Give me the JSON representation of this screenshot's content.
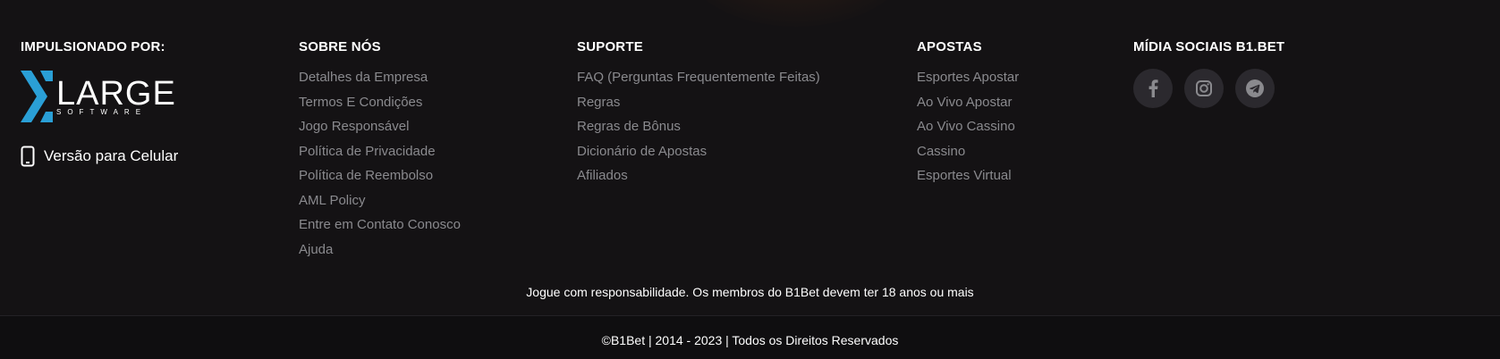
{
  "powered": {
    "heading": "IMPULSIONADO POR:",
    "logo_main": "LARGE",
    "logo_sub": "SOFTWARE",
    "mobile_label": "Versão para Celular"
  },
  "about": {
    "heading": "SOBRE NÓS",
    "links": [
      "Detalhes da Empresa",
      "Termos E Condições",
      "Jogo Responsável",
      "Política de Privacidade",
      "Política de Reembolso",
      "AML Policy",
      "Entre em Contato Conosco",
      "Ajuda"
    ]
  },
  "support": {
    "heading": "SUPORTE",
    "links": [
      "FAQ (Perguntas Frequentemente Feitas)",
      "Regras",
      "Regras de Bônus",
      "Dicionário de Apostas",
      "Afiliados"
    ]
  },
  "bets": {
    "heading": "APOSTAS",
    "links": [
      "Esportes Apostar",
      "Ao Vivo Apostar",
      "Ao Vivo Cassino",
      "Cassino",
      "Esportes Virtual"
    ]
  },
  "social": {
    "heading": "MÍDIA SOCIAIS B1.BET",
    "icons": [
      "facebook-icon",
      "instagram-icon",
      "telegram-icon"
    ]
  },
  "footer": {
    "responsible": "Jogue com responsabilidade. Os membros do B1Bet devem ter 18 anos ou mais",
    "copyright": "©B1Bet | 2014 - 2023 | Todos os Direitos Reservados"
  },
  "colors": {
    "background": "#141214",
    "link": "#8a8a8e",
    "logo_accent": "#2a9fd6",
    "social_bg": "#2b292e"
  }
}
